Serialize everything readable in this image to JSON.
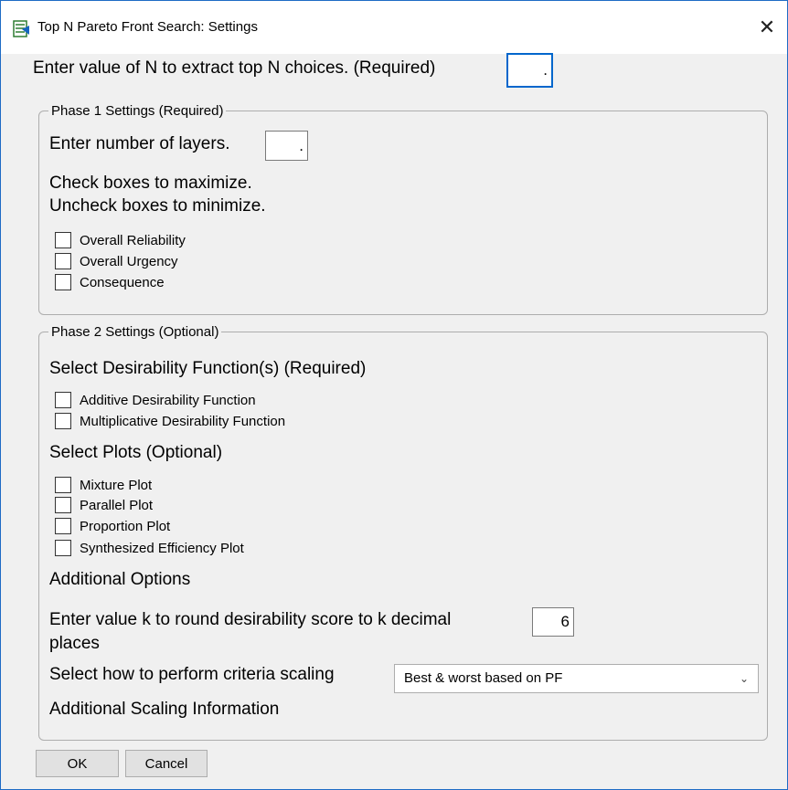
{
  "window": {
    "title": "Top N Pareto Front Search: Settings"
  },
  "top": {
    "n_prompt": "Enter value of N to extract top N choices. (Required)",
    "n_value": "."
  },
  "phase1": {
    "legend": "Phase 1 Settings (Required)",
    "layers_prompt": "Enter number of layers.",
    "layers_value": ".",
    "instruction_1": "Check boxes to maximize.",
    "instruction_2": "Uncheck boxes to minimize.",
    "criteria": [
      {
        "label": "Overall Reliability",
        "checked": false
      },
      {
        "label": "Overall Urgency",
        "checked": false
      },
      {
        "label": "Consequence",
        "checked": false
      }
    ]
  },
  "phase2": {
    "legend": "Phase 2 Settings (Optional)",
    "desirability_heading": "Select Desirability Function(s) (Required)",
    "desirability_functions": [
      {
        "label": "Additive Desirability Function",
        "checked": false
      },
      {
        "label": "Multiplicative Desirability Function",
        "checked": false
      }
    ],
    "plots_heading": "Select Plots (Optional)",
    "plots": [
      {
        "label": "Mixture Plot",
        "checked": false
      },
      {
        "label": "Parallel Plot",
        "checked": false
      },
      {
        "label": "Proportion Plot",
        "checked": false
      },
      {
        "label": "Synthesized Efficiency Plot",
        "checked": false
      }
    ],
    "additional_heading": "Additional Options",
    "round_prompt_1": "Enter value k to round desirability score to k decimal",
    "round_prompt_2": "places",
    "round_value": "6",
    "scaling_prompt": "Select how to perform criteria scaling",
    "scaling_selected": "Best & worst based on PF",
    "scaling_info": "Additional Scaling Information"
  },
  "buttons": {
    "ok": "OK",
    "cancel": "Cancel"
  },
  "colors": {
    "focus": "#0066cc",
    "window_border": "#1e6bc5",
    "dialog_bg": "#f0f0f0"
  }
}
